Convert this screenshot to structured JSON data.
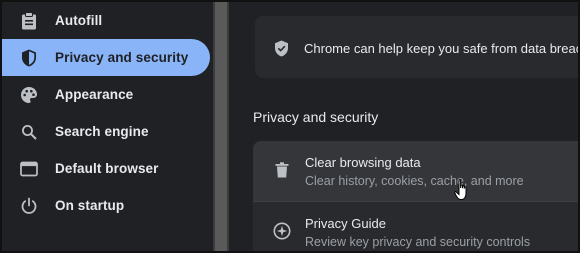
{
  "sidebar": {
    "items": [
      {
        "label": "Autofill",
        "icon": "clipboard-icon",
        "active": false
      },
      {
        "label": "Privacy and security",
        "icon": "shield-icon",
        "active": true
      },
      {
        "label": "Appearance",
        "icon": "palette-icon",
        "active": false
      },
      {
        "label": "Search engine",
        "icon": "search-icon",
        "active": false
      },
      {
        "label": "Default browser",
        "icon": "browser-window-icon",
        "active": false
      },
      {
        "label": "On startup",
        "icon": "power-icon",
        "active": false
      }
    ]
  },
  "main": {
    "banner_text": "Chrome can help keep you safe from data breaches",
    "section_title": "Privacy and security",
    "rows": [
      {
        "title": "Clear browsing data",
        "subtitle": "Clear history, cookies, cache, and more",
        "icon": "trash-icon"
      },
      {
        "title": "Privacy Guide",
        "subtitle": "Review key privacy and security controls",
        "icon": "compass-icon"
      }
    ]
  },
  "colors": {
    "accent": "#8ab4f8",
    "background": "#202124",
    "card": "#292a2d",
    "text_primary": "#e8eaed",
    "text_secondary": "#9aa0a6"
  }
}
